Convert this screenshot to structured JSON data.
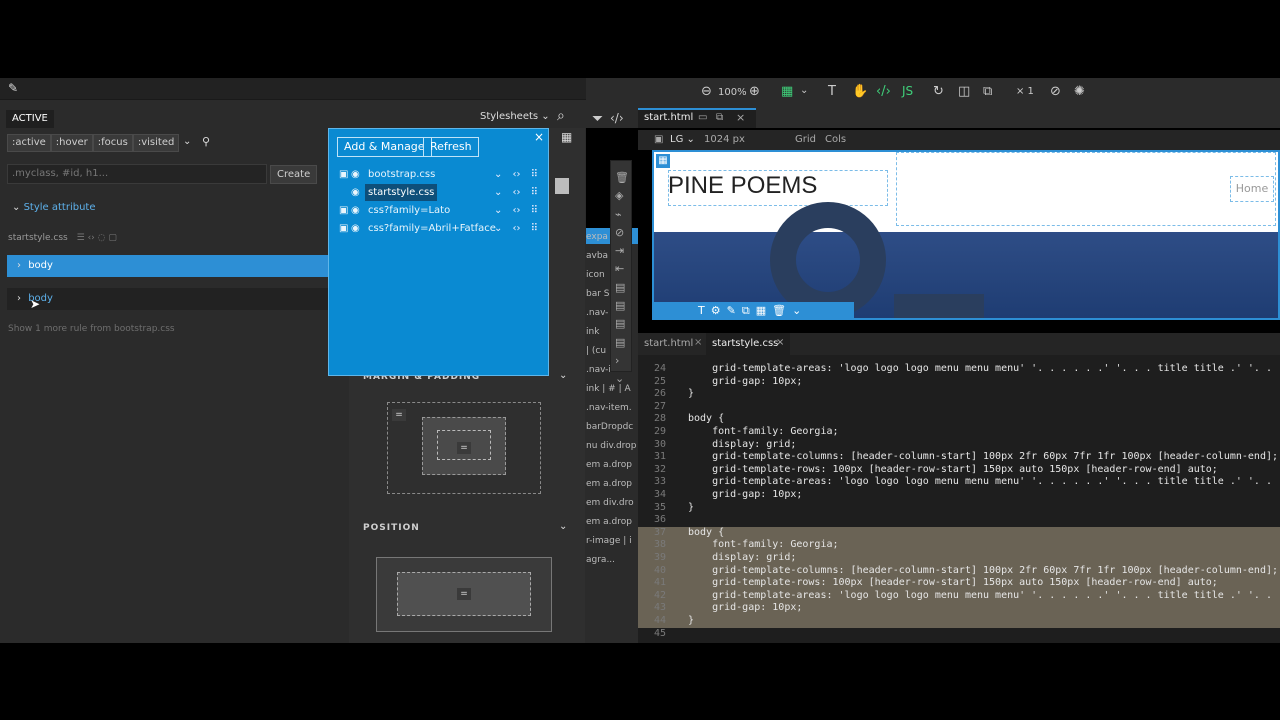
{
  "left_panel": {
    "tab_active": "ACTIVE",
    "stylesheets_label": "Stylesheets",
    "pseudo": [
      ":active",
      ":hover",
      ":focus",
      ":visited"
    ],
    "class_placeholder": ".myclass, #id, h1...",
    "create_label": "Create",
    "style_attribute": "Style attribute",
    "source_file": "startstyle.css",
    "rule1": "body",
    "rule2": "body",
    "more_rules": "Show 1 more rule from bootstrap.css"
  },
  "popup": {
    "add_manage": "Add & Manage",
    "refresh": "Refresh",
    "sheets": [
      "bootstrap.css",
      "startstyle.css",
      "css?family=Lato",
      "css?family=Abril+Fatface"
    ],
    "selected_index": 1
  },
  "props": {
    "margin_padding": "MARGIN & PADDING",
    "position": "POSITION",
    "peek_items": [
      "expa",
      "avba",
      "icon",
      "bar S",
      ".nav-",
      "ink",
      "| (cu",
      ".nav-item",
      "ink | # | A",
      ".nav-item.",
      "barDropdc",
      "nu div.drop",
      "em a.drop",
      "em a.drop",
      "em div.dro",
      "em a.drop",
      "r-image | i",
      "agra..."
    ]
  },
  "toolbar": {
    "zoom": "100%",
    "multiplier": "× 1"
  },
  "page_tabs": {
    "tab": "start.html"
  },
  "canvas_bar": {
    "breakpoint": "LG",
    "width": "1024 px",
    "grid": "Grid",
    "cols": "Cols"
  },
  "canvas": {
    "title": "PINE POEMS",
    "nav_home": "Home"
  },
  "editor_tabs": [
    "start.html",
    "startstyle.css"
  ],
  "code_lines": [
    {
      "n": "24",
      "t": "    grid-template-areas: 'logo logo logo menu menu menu' '. . . . . .' '. . . title title .' '. . . aut"
    },
    {
      "n": "25",
      "t": "    grid-gap: 10px;"
    },
    {
      "n": "26",
      "t": "}"
    },
    {
      "n": "27",
      "t": ""
    },
    {
      "n": "28",
      "t": "body {"
    },
    {
      "n": "29",
      "t": "    font-family: Georgia;"
    },
    {
      "n": "30",
      "t": "    display: grid;"
    },
    {
      "n": "31",
      "t": "    grid-template-columns: [header-column-start] 100px 2fr 60px 7fr 1fr 100px [header-column-end];"
    },
    {
      "n": "32",
      "t": "    grid-template-rows: 100px [header-row-start] 150px auto 150px [header-row-end] auto;"
    },
    {
      "n": "33",
      "t": "    grid-template-areas: 'logo logo logo menu menu menu' '. . . . . .' '. . . title title .' '. . . aut"
    },
    {
      "n": "34",
      "t": "    grid-gap: 10px;"
    },
    {
      "n": "35",
      "t": "}"
    },
    {
      "n": "36",
      "t": ""
    },
    {
      "n": "37",
      "t": "body {"
    },
    {
      "n": "38",
      "t": "    font-family: Georgia;"
    },
    {
      "n": "39",
      "t": "    display: grid;"
    },
    {
      "n": "40",
      "t": "    grid-template-columns: [header-column-start] 100px 2fr 60px 7fr 1fr 100px [header-column-end];"
    },
    {
      "n": "41",
      "t": "    grid-template-rows: 100px [header-row-start] 150px auto 150px [header-row-end] auto;"
    },
    {
      "n": "42",
      "t": "    grid-template-areas: 'logo logo logo menu menu menu' '. . . . . .' '. . . title title .' '. . . aut"
    },
    {
      "n": "43",
      "t": "    grid-gap: 10px;"
    },
    {
      "n": "44",
      "t": "}"
    },
    {
      "n": "45",
      "t": ""
    }
  ],
  "highlight_lines": [
    "37",
    "38",
    "39",
    "40",
    "41",
    "42",
    "43",
    "44"
  ],
  "colors": {
    "accent": "#2d8fd5",
    "popup": "#0a8ad2",
    "highlight": "#6a6355"
  }
}
